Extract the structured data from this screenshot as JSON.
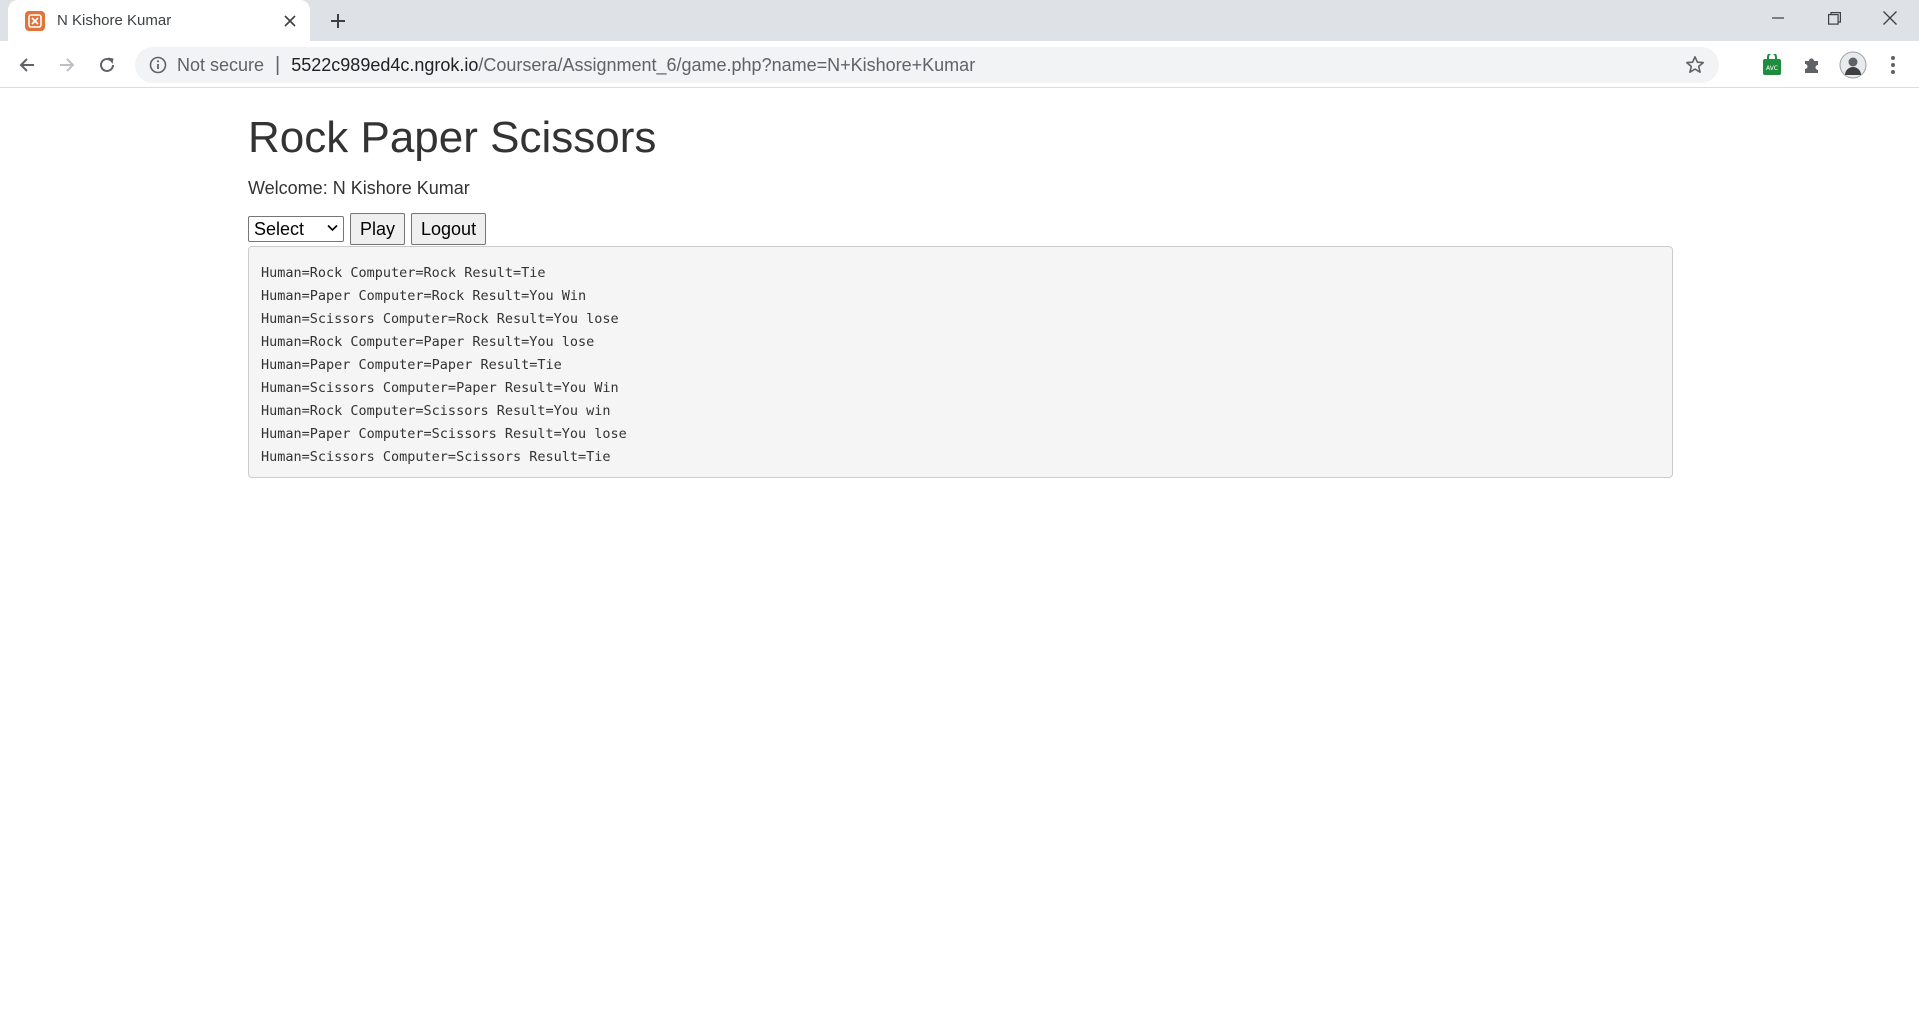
{
  "browser": {
    "tab": {
      "title": "N Kishore Kumar"
    },
    "address_bar": {
      "security_label": "Not secure",
      "url_host": "5522c989ed4c.ngrok.io",
      "url_path": "/Coursera/Assignment_6/game.php?name=N+Kishore+Kumar"
    },
    "icons": {
      "favicon": "xampp-icon",
      "new_tab": "plus-icon",
      "back": "arrow-left-icon",
      "forward": "arrow-right-icon",
      "reload": "reload-icon",
      "info": "info-icon",
      "bookmark": "star-icon",
      "extension_1": "avc-extension-icon",
      "extensions": "puzzle-icon",
      "profile": "avatar",
      "menu": "kebab-menu-icon"
    }
  },
  "page": {
    "heading": "Rock Paper Scissors",
    "welcome": "Welcome: N Kishore Kumar",
    "select": {
      "value": "Select"
    },
    "play_label": "Play",
    "logout_label": "Logout",
    "results": [
      "Human=Rock Computer=Rock Result=Tie",
      "Human=Paper Computer=Rock Result=You Win",
      "Human=Scissors Computer=Rock Result=You lose",
      "Human=Rock Computer=Paper Result=You lose",
      "Human=Paper Computer=Paper Result=Tie",
      "Human=Scissors Computer=Paper Result=You Win",
      "Human=Rock Computer=Scissors Result=You win",
      "Human=Paper Computer=Scissors Result=You lose",
      "Human=Scissors Computer=Scissors Result=Tie"
    ]
  }
}
